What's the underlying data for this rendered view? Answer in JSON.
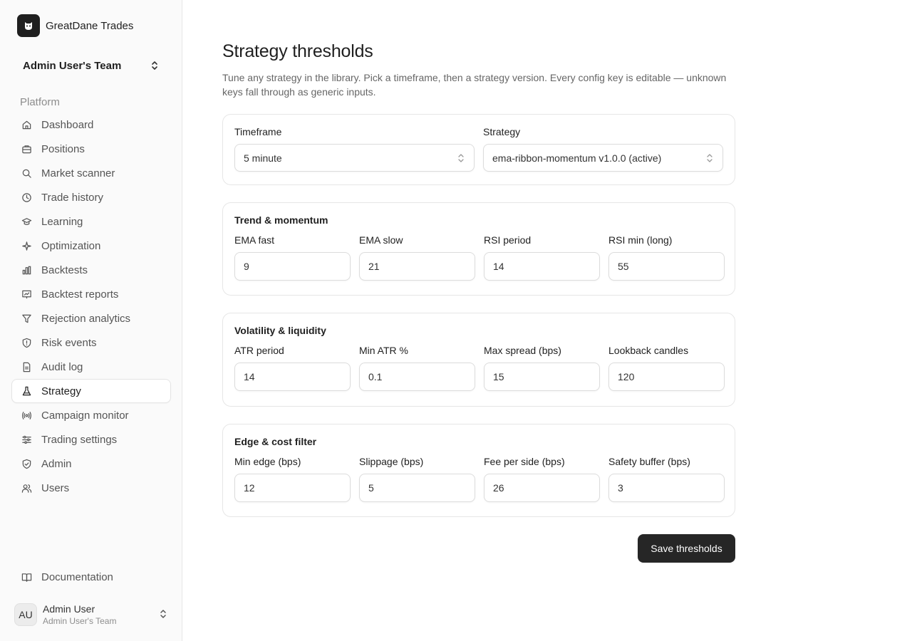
{
  "brand": {
    "name": "GreatDane Trades",
    "logo_icon": "dog-icon"
  },
  "team": {
    "name": "Admin User's Team"
  },
  "sidebar": {
    "section_label": "Platform",
    "items": [
      {
        "label": "Dashboard",
        "icon": "home-icon"
      },
      {
        "label": "Positions",
        "icon": "briefcase-icon"
      },
      {
        "label": "Market scanner",
        "icon": "search-icon"
      },
      {
        "label": "Trade history",
        "icon": "clock-icon"
      },
      {
        "label": "Learning",
        "icon": "graduation-cap-icon"
      },
      {
        "label": "Optimization",
        "icon": "sparkles-icon"
      },
      {
        "label": "Backtests",
        "icon": "bar-chart-icon"
      },
      {
        "label": "Backtest reports",
        "icon": "presentation-chart-icon"
      },
      {
        "label": "Rejection analytics",
        "icon": "filter-icon"
      },
      {
        "label": "Risk events",
        "icon": "shield-alert-icon"
      },
      {
        "label": "Audit log",
        "icon": "file-text-icon"
      },
      {
        "label": "Strategy",
        "icon": "flask-icon",
        "active": true
      },
      {
        "label": "Campaign monitor",
        "icon": "radio-icon"
      },
      {
        "label": "Trading settings",
        "icon": "sliders-icon"
      },
      {
        "label": "Admin",
        "icon": "shield-check-icon"
      },
      {
        "label": "Users",
        "icon": "users-icon"
      }
    ],
    "docs_label": "Documentation"
  },
  "user": {
    "initials": "AU",
    "name": "Admin User",
    "team": "Admin User's Team"
  },
  "page": {
    "title": "Strategy thresholds",
    "description": "Tune any strategy in the library. Pick a timeframe, then a strategy version. Every config key is editable — unknown keys fall through as generic inputs."
  },
  "selectors": {
    "timeframe_label": "Timeframe",
    "timeframe_value": "5 minute",
    "strategy_label": "Strategy",
    "strategy_value": "ema-ribbon-momentum v1.0.0 (active)"
  },
  "groups": [
    {
      "title": "Trend & momentum",
      "fields": [
        {
          "label": "EMA fast",
          "value": "9"
        },
        {
          "label": "EMA slow",
          "value": "21"
        },
        {
          "label": "RSI period",
          "value": "14"
        },
        {
          "label": "RSI min (long)",
          "value": "55"
        }
      ]
    },
    {
      "title": "Volatility & liquidity",
      "fields": [
        {
          "label": "ATR period",
          "value": "14"
        },
        {
          "label": "Min ATR %",
          "value": "0.1"
        },
        {
          "label": "Max spread (bps)",
          "value": "15"
        },
        {
          "label": "Lookback candles",
          "value": "120"
        }
      ]
    },
    {
      "title": "Edge & cost filter",
      "fields": [
        {
          "label": "Min edge (bps)",
          "value": "12"
        },
        {
          "label": "Slippage (bps)",
          "value": "5"
        },
        {
          "label": "Fee per side (bps)",
          "value": "26"
        },
        {
          "label": "Safety buffer (bps)",
          "value": "3"
        }
      ]
    }
  ],
  "actions": {
    "save_label": "Save thresholds"
  }
}
